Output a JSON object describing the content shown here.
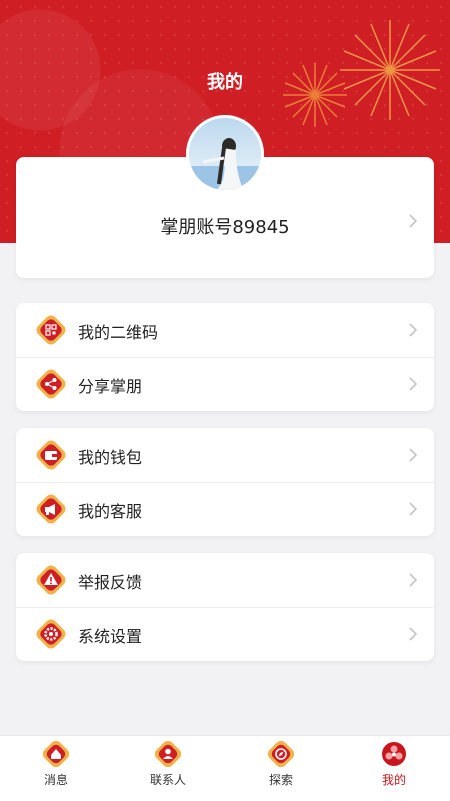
{
  "header": {
    "title": "我的"
  },
  "profile": {
    "account": "掌朋账号89845"
  },
  "menu_groups": [
    {
      "items": [
        {
          "label": "我的二维码",
          "icon": "qrcode-icon"
        },
        {
          "label": "分享掌朋",
          "icon": "share-icon"
        }
      ]
    },
    {
      "items": [
        {
          "label": "我的钱包",
          "icon": "wallet-icon"
        },
        {
          "label": "我的客服",
          "icon": "customer-service-icon"
        }
      ]
    },
    {
      "items": [
        {
          "label": "举报反馈",
          "icon": "warning-icon"
        },
        {
          "label": "系统设置",
          "icon": "settings-icon"
        }
      ]
    }
  ],
  "tabbar": {
    "tabs": [
      {
        "label": "消息",
        "icon": "message-icon"
      },
      {
        "label": "联系人",
        "icon": "contacts-icon"
      },
      {
        "label": "探索",
        "icon": "explore-icon"
      },
      {
        "label": "我的",
        "icon": "mine-icon",
        "active": true
      }
    ]
  },
  "colors": {
    "brand_red": "#cf1e24",
    "accent_gold": "#f0b24b",
    "active_tab": "#c8161d"
  }
}
